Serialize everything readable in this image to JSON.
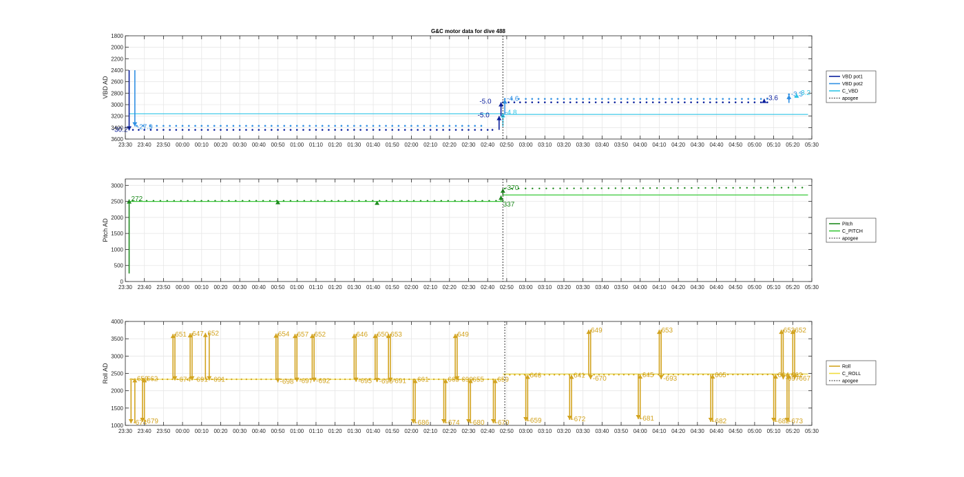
{
  "figure_title": "G&C motor data for dive 488",
  "colors": {
    "vbd_pot1": "#0a1f9c",
    "vbd_pot2": "#2f8fe3",
    "c_vbd": "#2ec4e6",
    "pitch": "#1e8a1e",
    "c_pitch": "#37c837",
    "roll": "#d2a31f",
    "c_roll": "#f0dc3a",
    "apogee": "#333333",
    "grid": "#e6e6e6",
    "axes": "#262626"
  },
  "chart_data": [
    {
      "type": "scatter",
      "ylabel": "VBD AD",
      "ylim": [
        1800,
        3600
      ],
      "y_reversed": true,
      "yticks": [
        1800,
        2000,
        2200,
        2400,
        2600,
        2800,
        3000,
        3200,
        3400,
        3600
      ],
      "xlim_min": [
        -30,
        330
      ],
      "xticks_min": [
        -30,
        -20,
        -10,
        0,
        10,
        20,
        30,
        40,
        50,
        60,
        70,
        80,
        90,
        100,
        110,
        120,
        130,
        140,
        150,
        160,
        170,
        180,
        190,
        200,
        210,
        220,
        230,
        240,
        250,
        260,
        270,
        280,
        290,
        300,
        310,
        320,
        330
      ],
      "xtick_labels": [
        "23:30",
        "23:40",
        "23:50",
        "00:00",
        "00:10",
        "00:20",
        "00:30",
        "00:40",
        "00:50",
        "01:00",
        "01:10",
        "01:20",
        "01:30",
        "01:40",
        "01:50",
        "02:00",
        "02:10",
        "02:20",
        "02:30",
        "02:40",
        "02:50",
        "03:00",
        "03:10",
        "03:20",
        "03:30",
        "03:40",
        "03:50",
        "04:00",
        "04:10",
        "04:20",
        "04:30",
        "04:40",
        "04:50",
        "05:00",
        "05:10",
        "05:20",
        "05:30"
      ],
      "apogee_min": 168,
      "legend": [
        "VBD pot1",
        "VBD pot2",
        "C_VBD",
        "apogee"
      ],
      "legend_position": "right",
      "commanded": {
        "name": "C_VBD",
        "segments": [
          [
            -28,
            168,
            3160
          ],
          [
            168,
            328,
            3170
          ]
        ]
      },
      "series": [
        {
          "name": "VBD pot1",
          "color_key": "vbd_pot1",
          "points": [
            [
              -26,
              3440
            ],
            [
              -20,
              3440
            ],
            [
              -10,
              3440
            ],
            [
              0,
              3440
            ],
            [
              10,
              3440
            ],
            [
              20,
              3440
            ],
            [
              30,
              3440
            ],
            [
              40,
              3440
            ],
            [
              50,
              3440
            ],
            [
              60,
              3440
            ],
            [
              70,
              3440
            ],
            [
              80,
              3440
            ],
            [
              90,
              3440
            ],
            [
              100,
              3440
            ],
            [
              110,
              3440
            ],
            [
              120,
              3440
            ],
            [
              130,
              3440
            ],
            [
              140,
              3440
            ],
            [
              150,
              3440
            ],
            [
              160,
              3440
            ],
            [
              165,
              3440
            ],
            [
              168,
              2960
            ],
            [
              180,
              2960
            ],
            [
              190,
              2960
            ],
            [
              200,
              2960
            ],
            [
              210,
              2960
            ],
            [
              220,
              2960
            ],
            [
              230,
              2960
            ],
            [
              240,
              2960
            ],
            [
              250,
              2960
            ],
            [
              260,
              2960
            ],
            [
              270,
              2960
            ],
            [
              280,
              2960
            ],
            [
              290,
              2960
            ],
            [
              300,
              2960
            ],
            [
              310,
              2960
            ],
            [
              318,
              2900
            ],
            [
              322,
              2880
            ]
          ]
        },
        {
          "name": "VBD pot2",
          "color_key": "vbd_pot2",
          "points": [
            [
              -24,
              3370
            ],
            [
              -10,
              3370
            ],
            [
              0,
              3370
            ],
            [
              10,
              3370
            ],
            [
              20,
              3370
            ],
            [
              30,
              3370
            ],
            [
              40,
              3370
            ],
            [
              50,
              3370
            ],
            [
              60,
              3370
            ],
            [
              70,
              3370
            ],
            [
              80,
              3370
            ],
            [
              90,
              3370
            ],
            [
              100,
              3370
            ],
            [
              110,
              3370
            ],
            [
              120,
              3370
            ],
            [
              130,
              3370
            ],
            [
              140,
              3370
            ],
            [
              150,
              3370
            ],
            [
              160,
              3370
            ],
            [
              169,
              2900
            ],
            [
              180,
              2900
            ],
            [
              190,
              2900
            ],
            [
              200,
              2900
            ],
            [
              210,
              2900
            ],
            [
              220,
              2900
            ],
            [
              230,
              2900
            ],
            [
              240,
              2900
            ],
            [
              250,
              2900
            ],
            [
              260,
              2900
            ],
            [
              270,
              2900
            ],
            [
              280,
              2900
            ],
            [
              290,
              2900
            ],
            [
              300,
              2900
            ],
            [
              310,
              2900
            ],
            [
              318,
              2820
            ],
            [
              322,
              2800
            ]
          ]
        }
      ],
      "events": [
        {
          "t": -28,
          "y_from": 2400,
          "y_to": 3450,
          "color_key": "vbd_pot1",
          "label": "-30.2",
          "dir": "down"
        },
        {
          "t": -25,
          "y_from": 2400,
          "y_to": 3380,
          "color_key": "vbd_pot2",
          "label": "-27.9",
          "dir": "down"
        },
        {
          "t": 166,
          "y_from": 3440,
          "y_to": 3200,
          "color_key": "vbd_pot1",
          "label": "-5.0",
          "dir": "up",
          "label_side": "left"
        },
        {
          "t": 167,
          "y_from": 3200,
          "y_to": 2960,
          "color_key": "vbd_pot1",
          "label": "-5.0",
          "dir": "up",
          "label_side": "left"
        },
        {
          "t": 169,
          "y_from": 3170,
          "y_to": 2910,
          "color_key": "vbd_pot2",
          "label": "-4.6",
          "dir": "up"
        },
        {
          "t": 168,
          "y_from": 3380,
          "y_to": 3150,
          "color_key": "c_vbd",
          "label": "-4.8",
          "dir": "up"
        },
        {
          "t": 305,
          "y_from": 2960,
          "y_to": 2900,
          "color_key": "vbd_pot1",
          "label": "-3.6",
          "dir": "up"
        },
        {
          "t": 318,
          "y_from": 2970,
          "y_to": 2830,
          "color_key": "vbd_pot2",
          "label": "-3.3",
          "dir": "up"
        },
        {
          "t": 322,
          "y_from": 2870,
          "y_to": 2810,
          "color_key": "c_vbd",
          "label": "-3.2",
          "dir": "up"
        }
      ]
    },
    {
      "type": "scatter",
      "ylabel": "Pitch AD",
      "ylim": [
        0,
        3200
      ],
      "yticks": [
        0,
        500,
        1000,
        1500,
        2000,
        2500,
        3000
      ],
      "xlim_min": [
        -30,
        330
      ],
      "apogee_min": 168,
      "legend": [
        "Pitch",
        "C_PITCH",
        "apogee"
      ],
      "legend_position": "right",
      "commanded": {
        "name": "C_PITCH",
        "segments": [
          [
            -28,
            168,
            2500
          ],
          [
            168,
            328,
            2700
          ]
        ]
      },
      "series": [
        {
          "name": "Pitch",
          "color_key": "pitch",
          "dense_from": -26,
          "dense_to": 325,
          "base": [
            [
              -26,
              2520
            ],
            [
              168,
              2520
            ],
            [
              169,
              2900
            ],
            [
              325,
              2930
            ]
          ]
        }
      ],
      "events": [
        {
          "t": -28,
          "y_from": 250,
          "y_to": 2560,
          "color_key": "pitch",
          "label": "272",
          "dir": "up"
        },
        {
          "t": 50,
          "y_from": 2540,
          "y_to": 2540,
          "color_key": "pitch",
          "label": "",
          "dir": "marker"
        },
        {
          "t": 102,
          "y_from": 2520,
          "y_to": 2520,
          "color_key": "pitch",
          "label": "",
          "dir": "marker"
        },
        {
          "t": 167,
          "y_from": 2520,
          "y_to": 2680,
          "color_key": "pitch",
          "label": "337",
          "dir": "up",
          "label_below": true
        },
        {
          "t": 168,
          "y_from": 2680,
          "y_to": 2900,
          "color_key": "pitch",
          "label": "-370",
          "dir": "up"
        }
      ]
    },
    {
      "type": "scatter",
      "ylabel": "Roll AD",
      "ylim": [
        1000,
        4000
      ],
      "yticks": [
        1000,
        1500,
        2000,
        2500,
        3000,
        3500,
        4000
      ],
      "xlim_min": [
        -30,
        330
      ],
      "apogee_min": 169,
      "legend": [
        "Roll",
        "C_ROLL",
        "apogee"
      ],
      "legend_position": "right",
      "commanded": {
        "name": "C_ROLL",
        "segments": [
          [
            -28,
            168,
            2330
          ],
          [
            168,
            328,
            2480
          ]
        ]
      },
      "series": [
        {
          "name": "Roll",
          "color_key": "roll",
          "base": [
            [
              -26,
              2330
            ],
            [
              168,
              2330
            ],
            [
              169,
              2460
            ],
            [
              325,
              2470
            ]
          ]
        }
      ],
      "events": [
        {
          "t": -27,
          "y_from": 2360,
          "y_to": 1060,
          "label": "-674",
          "dir": "down"
        },
        {
          "t": -25,
          "y_from": 1060,
          "y_to": 2360,
          "label": "659",
          "dir": "up"
        },
        {
          "t": -21,
          "y_from": 2360,
          "y_to": 1100,
          "label": "-679",
          "dir": "down"
        },
        {
          "t": -20,
          "y_from": 1100,
          "y_to": 2360,
          "label": "662",
          "dir": "up"
        },
        {
          "t": -5,
          "y_from": 2350,
          "y_to": 3640,
          "label": "651",
          "dir": "up"
        },
        {
          "t": -4,
          "y_from": 3640,
          "y_to": 2300,
          "label": "-674",
          "dir": "down"
        },
        {
          "t": 4,
          "y_from": 2340,
          "y_to": 3660,
          "label": "647",
          "dir": "up"
        },
        {
          "t": 5,
          "y_from": 3660,
          "y_to": 2300,
          "label": "-691",
          "dir": "down"
        },
        {
          "t": 12,
          "y_from": 2340,
          "y_to": 3670,
          "label": "652",
          "dir": "up"
        },
        {
          "t": 14,
          "y_from": 3670,
          "y_to": 2300,
          "label": "-691",
          "dir": "down"
        },
        {
          "t": 49,
          "y_from": 2320,
          "y_to": 3650,
          "label": "654",
          "dir": "up"
        },
        {
          "t": 50,
          "y_from": 3650,
          "y_to": 2240,
          "label": "-698",
          "dir": "down"
        },
        {
          "t": 59,
          "y_from": 2320,
          "y_to": 3640,
          "label": "657",
          "dir": "up"
        },
        {
          "t": 60,
          "y_from": 3640,
          "y_to": 2260,
          "label": "-697",
          "dir": "down"
        },
        {
          "t": 68,
          "y_from": 2320,
          "y_to": 3640,
          "label": "652",
          "dir": "up"
        },
        {
          "t": 69,
          "y_from": 3640,
          "y_to": 2260,
          "label": "-692",
          "dir": "down"
        },
        {
          "t": 90,
          "y_from": 2330,
          "y_to": 3640,
          "label": "646",
          "dir": "up"
        },
        {
          "t": 91,
          "y_from": 3640,
          "y_to": 2260,
          "label": "-695",
          "dir": "down"
        },
        {
          "t": 101,
          "y_from": 2330,
          "y_to": 3640,
          "label": "650",
          "dir": "up"
        },
        {
          "t": 102,
          "y_from": 3640,
          "y_to": 2250,
          "label": "-696",
          "dir": "down"
        },
        {
          "t": 108,
          "y_from": 2330,
          "y_to": 3640,
          "label": "653",
          "dir": "up"
        },
        {
          "t": 109,
          "y_from": 3640,
          "y_to": 2260,
          "label": "-691",
          "dir": "down"
        },
        {
          "t": 121,
          "y_from": 2340,
          "y_to": 1060,
          "label": "-686",
          "dir": "down"
        },
        {
          "t": 122,
          "y_from": 1060,
          "y_to": 2340,
          "label": "661",
          "dir": "up"
        },
        {
          "t": 137,
          "y_from": 2340,
          "y_to": 1060,
          "label": "-674",
          "dir": "down"
        },
        {
          "t": 138,
          "y_from": 1060,
          "y_to": 2340,
          "label": "665",
          "dir": "up"
        },
        {
          "t": 143,
          "y_from": 2340,
          "y_to": 3640,
          "label": "649",
          "dir": "up"
        },
        {
          "t": 144,
          "y_from": 3640,
          "y_to": 2300,
          "label": "-699",
          "dir": "down"
        },
        {
          "t": 150,
          "y_from": 2340,
          "y_to": 1060,
          "label": "-680",
          "dir": "down"
        },
        {
          "t": 151,
          "y_from": 1060,
          "y_to": 2340,
          "label": "655",
          "dir": "up"
        },
        {
          "t": 163,
          "y_from": 2340,
          "y_to": 1060,
          "label": "-670",
          "dir": "down"
        },
        {
          "t": 164,
          "y_from": 1060,
          "y_to": 2340,
          "label": "659",
          "dir": "up"
        },
        {
          "t": 180,
          "y_from": 2460,
          "y_to": 1120,
          "label": "-659",
          "dir": "down"
        },
        {
          "t": 181,
          "y_from": 1120,
          "y_to": 2460,
          "label": "646",
          "dir": "up"
        },
        {
          "t": 203,
          "y_from": 2460,
          "y_to": 1160,
          "label": "-672",
          "dir": "down"
        },
        {
          "t": 204,
          "y_from": 1160,
          "y_to": 2460,
          "label": "641",
          "dir": "up"
        },
        {
          "t": 213,
          "y_from": 2440,
          "y_to": 3760,
          "label": "649",
          "dir": "up"
        },
        {
          "t": 214,
          "y_from": 3760,
          "y_to": 2330,
          "label": "-670",
          "dir": "down"
        },
        {
          "t": 239,
          "y_from": 2470,
          "y_to": 1180,
          "label": "-681",
          "dir": "down"
        },
        {
          "t": 240,
          "y_from": 1180,
          "y_to": 2470,
          "label": "645",
          "dir": "up"
        },
        {
          "t": 250,
          "y_from": 2460,
          "y_to": 3760,
          "label": "653",
          "dir": "up"
        },
        {
          "t": 251,
          "y_from": 3760,
          "y_to": 2330,
          "label": "-693",
          "dir": "down"
        },
        {
          "t": 277,
          "y_from": 2470,
          "y_to": 1100,
          "label": "-682",
          "dir": "down"
        },
        {
          "t": 278,
          "y_from": 1100,
          "y_to": 2470,
          "label": "665",
          "dir": "up"
        },
        {
          "t": 310,
          "y_from": 2470,
          "y_to": 1100,
          "label": "-682",
          "dir": "down"
        },
        {
          "t": 311,
          "y_from": 1100,
          "y_to": 2470,
          "label": "664",
          "dir": "up"
        },
        {
          "t": 314,
          "y_from": 2440,
          "y_to": 3760,
          "label": "653",
          "dir": "up"
        },
        {
          "t": 315,
          "y_from": 3760,
          "y_to": 2330,
          "label": "-697",
          "dir": "down"
        },
        {
          "t": 317,
          "y_from": 2470,
          "y_to": 1100,
          "label": "-673",
          "dir": "down"
        },
        {
          "t": 318,
          "y_from": 1100,
          "y_to": 2470,
          "label": "662",
          "dir": "up"
        },
        {
          "t": 320,
          "y_from": 2440,
          "y_to": 3760,
          "label": "652",
          "dir": "up"
        },
        {
          "t": 321,
          "y_from": 3760,
          "y_to": 2330,
          "label": "-667",
          "dir": "down"
        }
      ]
    }
  ]
}
